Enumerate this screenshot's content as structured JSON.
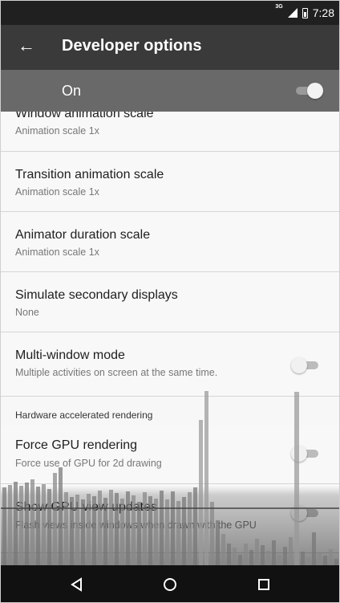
{
  "status_bar": {
    "network_label": "3G",
    "time": "7:28"
  },
  "app_bar": {
    "title": "Developer options",
    "back_icon": "back-arrow-icon"
  },
  "master_switch": {
    "label": "On",
    "enabled": true
  },
  "settings": {
    "rows": [
      {
        "title": "Window animation scale",
        "summary": "Animation scale 1x"
      },
      {
        "title": "Transition animation scale",
        "summary": "Animation scale 1x"
      },
      {
        "title": "Animator duration scale",
        "summary": "Animation scale 1x"
      },
      {
        "title": "Simulate secondary displays",
        "summary": "None"
      },
      {
        "title": "Multi-window mode",
        "summary": "Multiple activities on screen at the same time.",
        "enabled": false
      },
      {
        "title": "Force GPU rendering",
        "summary": "Force use of GPU for 2d drawing",
        "enabled": false
      },
      {
        "title": "Show GPU view updates",
        "summary": "Flash views inside windows when drawn with the GPU",
        "enabled": false
      }
    ],
    "section_header": "Hardware accelerated rendering"
  },
  "nav_bar": {
    "icons": [
      "back-triangle-icon",
      "home-circle-icon",
      "recents-square-icon"
    ]
  },
  "colors": {
    "status_bar": "#202020",
    "app_bar": "#3a3a3a",
    "master_bar": "#696969",
    "nav_bar": "#111111"
  }
}
